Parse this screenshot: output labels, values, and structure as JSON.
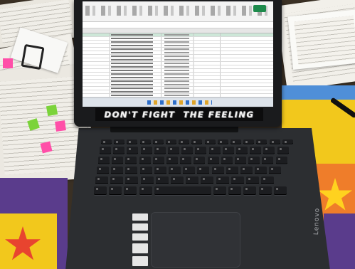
{
  "laptop": {
    "sticker_text": "DON'T FIGHT  THE FEELING",
    "brand": "Lenovo"
  },
  "colors": {
    "spreadsheet_accent": "#1d8a4c",
    "selected_row": "#cde7d8",
    "sticky_green": "#7bd33a",
    "sticky_pink": "#ff4fa8"
  }
}
